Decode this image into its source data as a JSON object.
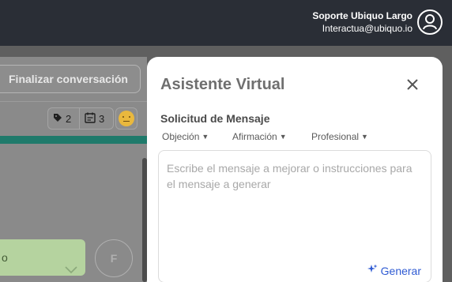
{
  "header": {
    "user_name": "Soporte Ubiquo Largo",
    "user_email": "Interactua@ubiquo.io"
  },
  "background": {
    "finalize_label": "Finalizar conversación",
    "tags_count": "2",
    "calendar_count": "3",
    "select_value": "o",
    "fab_label": "F"
  },
  "assistant": {
    "title": "Asistente Virtual",
    "section_title": "Solicitud de Mensaje",
    "options": [
      "Objeción",
      "Afirmación",
      "Profesional"
    ],
    "placeholder": "Escribe el mensaje a mejorar o instrucciones para el mensaje a generar",
    "generate_label": "Generar"
  },
  "colors": {
    "accent_blue": "#2f5bd3",
    "teal": "#1f7a6b",
    "topbar": "#2a2e36"
  }
}
